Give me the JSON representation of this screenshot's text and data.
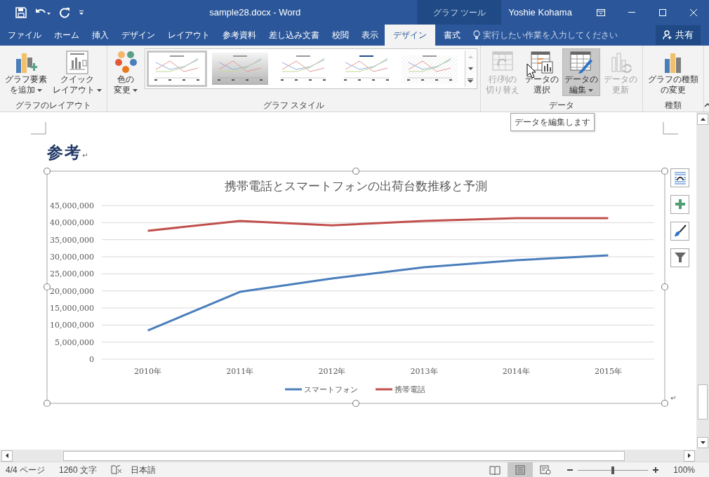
{
  "window": {
    "title": "sample28.docx - Word",
    "context_label": "グラフ ツール",
    "user": "Yoshie Kohama"
  },
  "tabs": [
    {
      "label": "ファイル",
      "selected": false,
      "contextual": false
    },
    {
      "label": "ホーム",
      "selected": false,
      "contextual": false
    },
    {
      "label": "挿入",
      "selected": false,
      "contextual": false
    },
    {
      "label": "デザイン",
      "selected": false,
      "contextual": false
    },
    {
      "label": "レイアウト",
      "selected": false,
      "contextual": false
    },
    {
      "label": "参考資料",
      "selected": false,
      "contextual": false
    },
    {
      "label": "差し込み文書",
      "selected": false,
      "contextual": false
    },
    {
      "label": "校閲",
      "selected": false,
      "contextual": false
    },
    {
      "label": "表示",
      "selected": false,
      "contextual": false
    },
    {
      "label": "デザイン",
      "selected": true,
      "contextual": true
    },
    {
      "label": "書式",
      "selected": false,
      "contextual": true
    }
  ],
  "tell_me": {
    "placeholder": "実行したい作業を入力してください"
  },
  "share_button": "共有",
  "ribbon_groups": [
    {
      "label": "グラフのレイアウト",
      "buttons": [
        {
          "lines": [
            "グラフ要素",
            "を追加"
          ],
          "dropdown": true,
          "disabled": false,
          "highlighted": false
        },
        {
          "lines": [
            "クイック",
            "レイアウト"
          ],
          "dropdown": true,
          "disabled": false,
          "highlighted": false
        }
      ]
    },
    {
      "label": "グラフ スタイル",
      "buttons": [
        {
          "lines": [
            "色の",
            "変更"
          ],
          "dropdown": true,
          "disabled": false,
          "highlighted": false
        }
      ],
      "styles": [
        {
          "selected": true
        },
        {
          "selected": false
        },
        {
          "selected": false
        },
        {
          "selected": false
        },
        {
          "selected": false
        }
      ]
    },
    {
      "label": "データ",
      "buttons": [
        {
          "lines": [
            "行/列の",
            "切り替え"
          ],
          "dropdown": false,
          "disabled": true,
          "highlighted": false
        },
        {
          "lines": [
            "データの",
            "選択"
          ],
          "dropdown": false,
          "disabled": false,
          "highlighted": false
        },
        {
          "lines": [
            "データの",
            "編集"
          ],
          "dropdown": true,
          "disabled": false,
          "highlighted": true
        },
        {
          "lines": [
            "データの",
            "更新"
          ],
          "dropdown": false,
          "disabled": true,
          "highlighted": false
        }
      ]
    },
    {
      "label": "種類",
      "buttons": [
        {
          "lines": [
            "グラフの種類",
            "の変更"
          ],
          "dropdown": false,
          "disabled": false,
          "highlighted": false
        }
      ]
    }
  ],
  "tooltip": "データを編集します",
  "document": {
    "heading": "参考",
    "heading_mark": "↵",
    "chart_end_mark": "↵",
    "chart": {
      "chart_data": {
        "type": "line",
        "title": "携帯電話とスマートフォンの出荷台数推移と予測",
        "categories": [
          "2010年",
          "2011年",
          "2012年",
          "2013年",
          "2014年",
          "2015年"
        ],
        "series": [
          {
            "name": "スマートフォン",
            "color": "#4a7ebb",
            "values": [
              8400000,
              19700000,
              23600000,
              26900000,
              29000000,
              30400000
            ]
          },
          {
            "name": "携帯電話",
            "color": "#c0504d",
            "values": [
              37600000,
              40500000,
              39200000,
              40500000,
              41300000,
              41300000
            ]
          }
        ],
        "ylim": [
          0,
          45000000
        ],
        "grid": true,
        "legend": true,
        "yticks": [
          {
            "value": 0,
            "label": "0"
          },
          {
            "value": 5000000,
            "label": "5,000,000"
          },
          {
            "value": 10000000,
            "label": "10,000,000"
          },
          {
            "value": 15000000,
            "label": "15,000,000"
          },
          {
            "value": 20000000,
            "label": "20,000,000"
          },
          {
            "value": 25000000,
            "label": "25,000,000"
          },
          {
            "value": 30000000,
            "label": "30,000,000"
          },
          {
            "value": 35000000,
            "label": "35,000,000"
          },
          {
            "value": 40000000,
            "label": "40,000,000"
          },
          {
            "value": 45000000,
            "label": "45,000,000"
          }
        ]
      }
    }
  },
  "status_bar": {
    "page": "4/4 ページ",
    "words": "1260 文字",
    "language": "日本語",
    "views": [
      {
        "selected": false
      },
      {
        "selected": true
      },
      {
        "selected": false
      }
    ],
    "zoom": {
      "level": 0.5
    },
    "zoom_text": "100%"
  }
}
